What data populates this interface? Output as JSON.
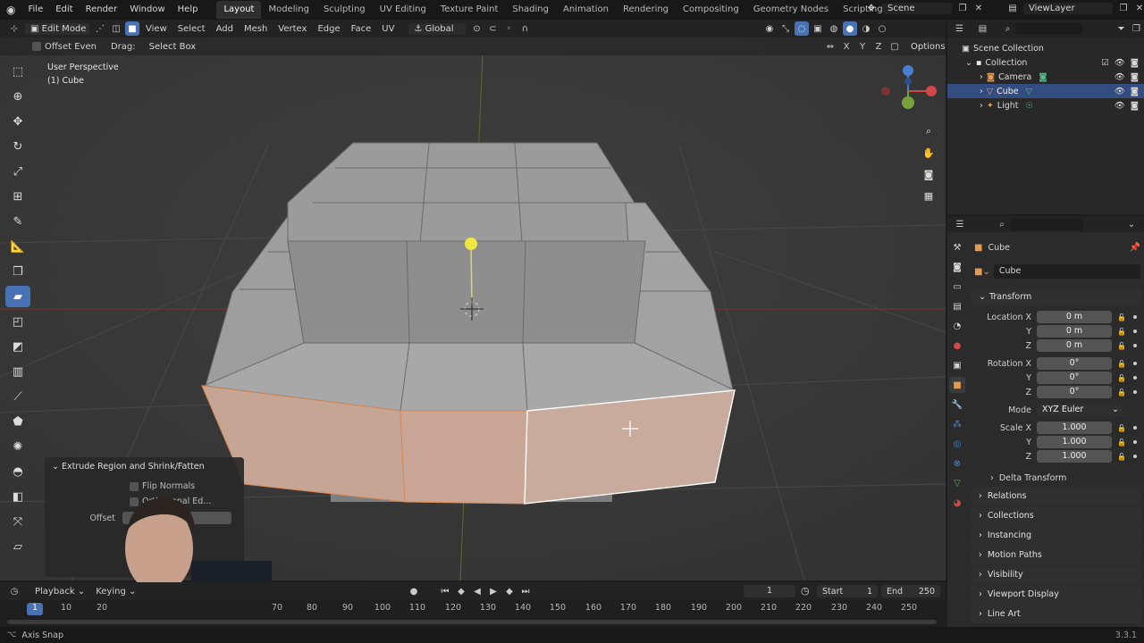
{
  "top_menu": {
    "items": [
      "File",
      "Edit",
      "Render",
      "Window",
      "Help"
    ]
  },
  "workspaces": [
    "Layout",
    "Modeling",
    "Sculpting",
    "UV Editing",
    "Texture Paint",
    "Shading",
    "Animation",
    "Rendering",
    "Compositing",
    "Geometry Nodes",
    "Scripting"
  ],
  "active_workspace": "Layout",
  "scene_label": "Scene",
  "view_layer_label": "ViewLayer",
  "viewport_header": {
    "mode": "Edit Mode",
    "menus": [
      "View",
      "Select",
      "Add",
      "Mesh",
      "Vertex",
      "Edge",
      "Face",
      "UV"
    ],
    "transform_orientation": "Global",
    "options_label": "Options",
    "axis_x": "X",
    "axis_y": "Y",
    "axis_z": "Z"
  },
  "tool_settings": {
    "offset_even_label": "Offset Even",
    "drag_label": "Drag:",
    "drag_value": "Select Box"
  },
  "viewport": {
    "view_name": "User Perspective",
    "object_info": "(1) Cube"
  },
  "operator_panel": {
    "title": "Extrude Region and Shrink/Fatten",
    "flip_normals_label": "Flip Normals",
    "orthogonal_label": "Orthogonal Ed...",
    "offset_label": "Offset"
  },
  "outliner": {
    "scene_collection": "Scene Collection",
    "collection": "Collection",
    "items": [
      {
        "label": "Camera",
        "selected": false
      },
      {
        "label": "Cube",
        "selected": true
      },
      {
        "label": "Light",
        "selected": false
      }
    ]
  },
  "properties": {
    "object_name": "Cube",
    "data_name": "Cube",
    "transform_title": "Transform",
    "location": {
      "label": "Location X",
      "x": "0 m",
      "y": "0 m",
      "z": "0 m"
    },
    "rotation": {
      "label": "Rotation X",
      "x": "0°",
      "y": "0°",
      "z": "0°"
    },
    "mode_label": "Mode",
    "mode_value": "XYZ Euler",
    "scale": {
      "label": "Scale X",
      "x": "1.000",
      "y": "1.000",
      "z": "1.000"
    },
    "y_label": "Y",
    "z_label": "Z",
    "delta_transform": "Delta Transform",
    "sections": [
      "Relations",
      "Collections",
      "Instancing",
      "Motion Paths",
      "Visibility",
      "Viewport Display",
      "Line Art"
    ]
  },
  "timeline": {
    "playback_label": "Playback",
    "keying_label": "Keying",
    "current_frame": "1",
    "start_label": "Start",
    "start_value": "1",
    "end_label": "End",
    "end_value": "250",
    "ticks": [
      "1",
      "10",
      "20",
      "70",
      "80",
      "90",
      "100",
      "110",
      "120",
      "130",
      "140",
      "150",
      "160",
      "170",
      "180",
      "190",
      "200",
      "210",
      "220",
      "230",
      "240",
      "250"
    ]
  },
  "status": {
    "left": "Axis Snap",
    "version": "3.3.1"
  },
  "colors": {
    "accent": "#4772b3",
    "selected_face": "#c9a48e",
    "active_edge": "#ffffff",
    "vertex_select": "#f5e642"
  }
}
